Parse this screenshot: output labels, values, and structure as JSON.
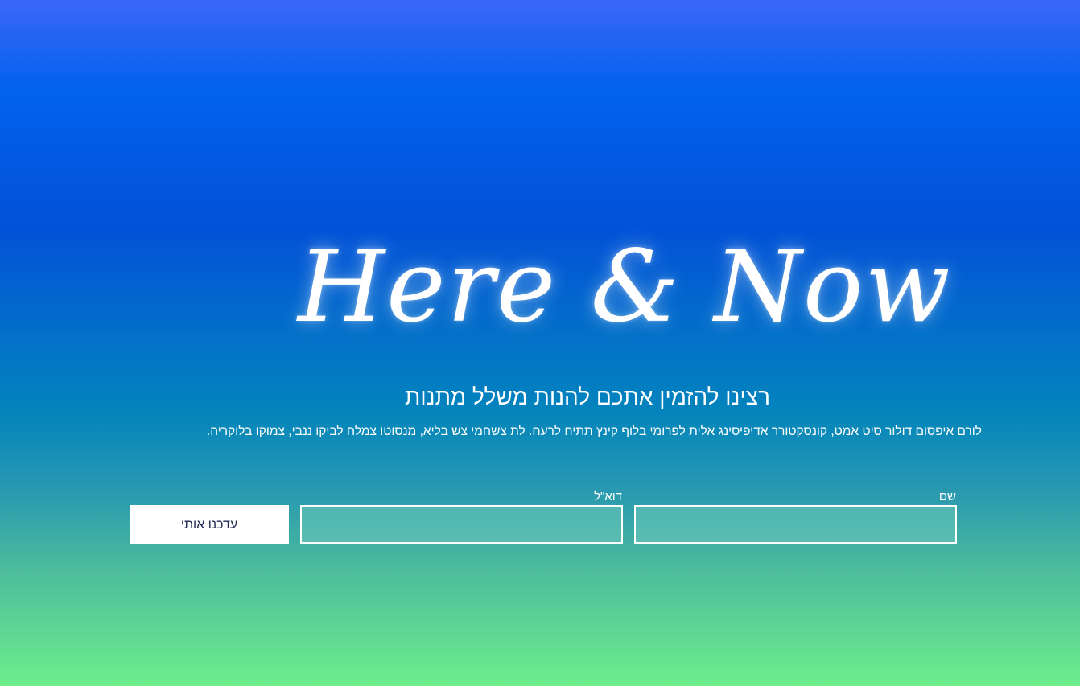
{
  "hero": {
    "title": "Here & Now",
    "subtitle": "רצינו להזמין אתכם להנות משלל מתנות",
    "description": "לורם איפסום דולור סיט אמט, קונסקטורר אדיפיסינג אלית לפרומי בלוף קינץ תתיח לרעח. לת צשחמי צש בליא, מנסוטו צמלח לביקו ננבי, צמוקו בלוקריה."
  },
  "form": {
    "name_label": "שם",
    "name_value": "",
    "email_label": "דוא\"ל",
    "email_value": "",
    "submit_label": "עדכנו אותי"
  },
  "colors": {
    "gradient_top": "#3c66f8",
    "gradient_mid": "#0351d8",
    "gradient_bottom": "#6eee8c",
    "button_text": "#222a55"
  }
}
